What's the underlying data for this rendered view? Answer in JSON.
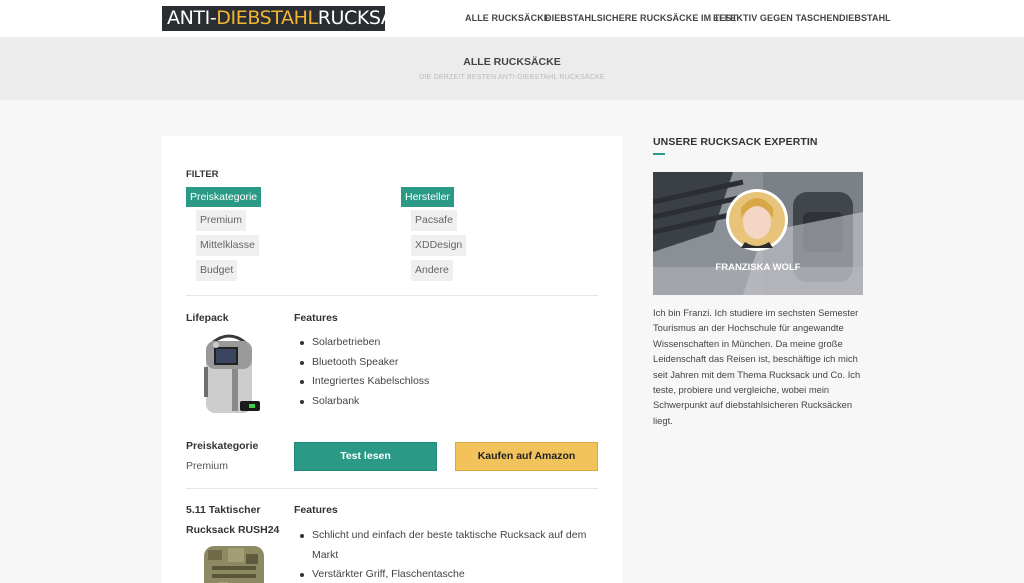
{
  "header": {
    "logo": {
      "part1": "ANTI-",
      "part2": "DIEBSTAHL",
      "part3": " RUCKSACK"
    },
    "nav": [
      {
        "label": "ALLE RUCKSÄCKE"
      },
      {
        "label": "DIEBSTAHLSICHERE RUCKSÄCKE IM TEST"
      },
      {
        "label": "EFFEKTIV GEGEN TASCHENDIEBSTAHL"
      }
    ]
  },
  "band": {
    "title": "ALLE RUCKSÄCKE",
    "subtitle": "DIE DERZEIT BESTEN ANTI-DIEBSTAHL RUCKSÄCKE"
  },
  "filter": {
    "title": "FILTER",
    "groups": [
      {
        "label": "Preiskategorie",
        "options": [
          "Premium",
          "Mittelklasse",
          "Budget"
        ]
      },
      {
        "label": "Hersteller",
        "options": [
          "Pacsafe",
          "XDDesign",
          "Andere"
        ]
      }
    ]
  },
  "products": [
    {
      "name": "Lifepack",
      "features_title": "Features",
      "features": [
        "Solarbetrieben",
        "Bluetooth Speaker",
        "Integriertes Kabelschloss",
        "Solarbank"
      ],
      "price_title": "Preiskategorie",
      "price_value": "Premium",
      "test_label": "Test lesen",
      "buy_label": "Kaufen auf Amazon"
    },
    {
      "name_line1": "5.11 Taktischer",
      "name_line2": "Rucksack RUSH24",
      "features_title": "Features",
      "feature1_line1": "Schlicht und einfach der beste taktische Rucksack auf dem",
      "feature1_line2": "Markt",
      "feature2": "Verstärkter Griff, Flaschentasche"
    }
  ],
  "sidebar": {
    "title": "UNSERE RUCKSACK EXPERTIN",
    "expert_name": "FRANZISKA WOLF",
    "bio_lines": [
      "Ich bin Franzi. Ich studiere im sechsten Semester",
      "Tourismus an der Hochschule für angewandte",
      "Wissenschaften in München. Da meine große",
      "Leidenschaft das Reisen ist, beschäftige ich mich",
      "seit Jahren mit dem Thema Rucksack und Co. Ich",
      "teste, probiere und vergleiche, wobei mein",
      "Schwerpunkt auf diebstahlsicheren Rucksäcken",
      "liegt."
    ]
  },
  "colors": {
    "accent": "#2a9a86",
    "amazon": "#f2c35b",
    "logo_bg": "#2a2d31",
    "logo_highlight": "#f2b632"
  }
}
